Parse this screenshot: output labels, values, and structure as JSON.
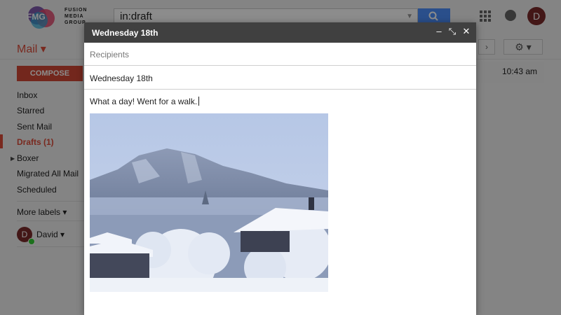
{
  "brand": {
    "logo_letters": "FMG",
    "logo_lines": [
      "FUSION",
      "MEDIA",
      "GROUP"
    ]
  },
  "search": {
    "value": "in:draft"
  },
  "account": {
    "avatar_letter": "D"
  },
  "mail_menu": {
    "label": "Mail ▾"
  },
  "sidebar": {
    "compose_label": "COMPOSE",
    "items": [
      {
        "label": "Inbox"
      },
      {
        "label": "Starred"
      },
      {
        "label": "Sent Mail"
      },
      {
        "label": "Drafts (1)"
      },
      {
        "label": "Boxer"
      },
      {
        "label": "Migrated All Mail"
      },
      {
        "label": "Scheduled"
      }
    ],
    "more_labels": "More labels ▾",
    "user": {
      "avatar_letter": "D",
      "name": "David ▾"
    }
  },
  "message_list": {
    "time": "10:43 am"
  },
  "compose": {
    "title": "Wednesday 18th",
    "controls": {
      "minimize": "–",
      "popout": "⤡",
      "close": "✕"
    },
    "recipients_placeholder": "Recipients",
    "subject": "Wednesday 18th",
    "body": "What a day! Went for a walk."
  },
  "colors": {
    "accent": "#dd4b39",
    "compose_button": "#d14836",
    "search_button": "#4d90fe",
    "compose_header": "#404040"
  }
}
